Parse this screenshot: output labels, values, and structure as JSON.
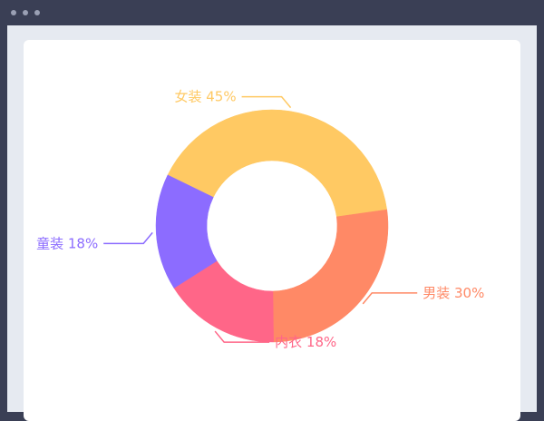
{
  "window": {
    "controls": [
      "window-dot",
      "window-dot",
      "window-dot"
    ]
  },
  "chart_data": {
    "type": "pie",
    "variant": "donut",
    "slices": [
      {
        "name": "女装",
        "label": "女装 45%",
        "value": 45,
        "color": "#ffc963"
      },
      {
        "name": "男装",
        "label": "男装 30%",
        "value": 30,
        "color": "#ff8966"
      },
      {
        "name": "内衣",
        "label": "内衣 18%",
        "value": 18,
        "color": "#ff6688"
      },
      {
        "name": "童装",
        "label": "童装 18%",
        "value": 18,
        "color": "#8c6cff"
      }
    ],
    "legend": "none"
  }
}
